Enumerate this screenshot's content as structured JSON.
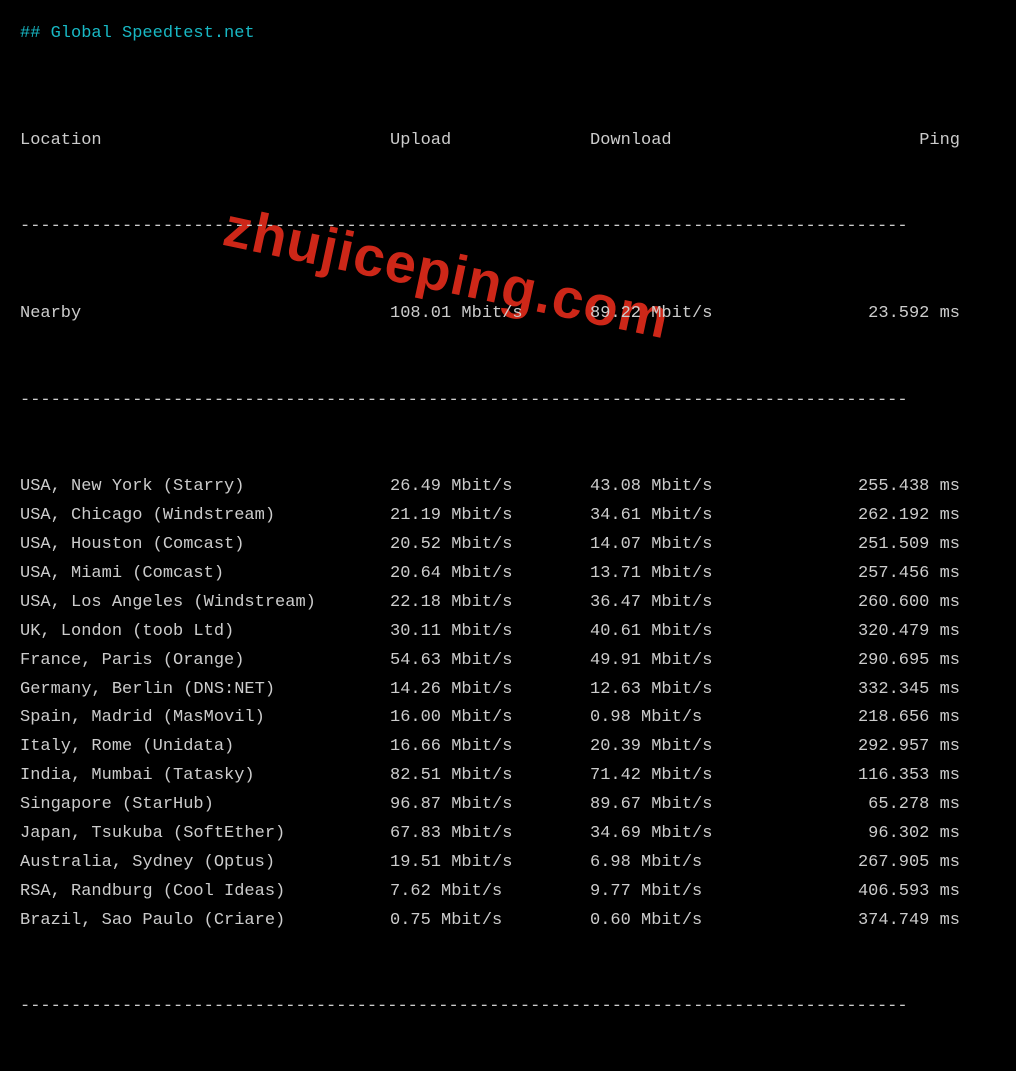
{
  "title": "## Global Speedtest.net",
  "headers": {
    "location": "Location",
    "upload": "Upload",
    "download": "Download",
    "ping": "Ping"
  },
  "separator": "---------------------------------------------------------------------------------------",
  "nearby": {
    "location": "Nearby",
    "upload": "108.01 Mbit/s",
    "download": "89.22 Mbit/s",
    "ping": "23.592 ms"
  },
  "rows": [
    {
      "location": "USA, New York (Starry)",
      "upload": "26.49 Mbit/s",
      "download": "43.08 Mbit/s",
      "ping": "255.438 ms"
    },
    {
      "location": "USA, Chicago (Windstream)",
      "upload": "21.19 Mbit/s",
      "download": "34.61 Mbit/s",
      "ping": "262.192 ms"
    },
    {
      "location": "USA, Houston (Comcast)",
      "upload": "20.52 Mbit/s",
      "download": "14.07 Mbit/s",
      "ping": "251.509 ms"
    },
    {
      "location": "USA, Miami (Comcast)",
      "upload": "20.64 Mbit/s",
      "download": "13.71 Mbit/s",
      "ping": "257.456 ms"
    },
    {
      "location": "USA, Los Angeles (Windstream)",
      "upload": "22.18 Mbit/s",
      "download": "36.47 Mbit/s",
      "ping": "260.600 ms"
    },
    {
      "location": "UK, London (toob Ltd)",
      "upload": "30.11 Mbit/s",
      "download": "40.61 Mbit/s",
      "ping": "320.479 ms"
    },
    {
      "location": "France, Paris (Orange)",
      "upload": "54.63 Mbit/s",
      "download": "49.91 Mbit/s",
      "ping": "290.695 ms"
    },
    {
      "location": "Germany, Berlin (DNS:NET)",
      "upload": "14.26 Mbit/s",
      "download": "12.63 Mbit/s",
      "ping": "332.345 ms"
    },
    {
      "location": "Spain, Madrid (MasMovil)",
      "upload": "16.00 Mbit/s",
      "download": "0.98 Mbit/s",
      "ping": "218.656 ms"
    },
    {
      "location": "Italy, Rome (Unidata)",
      "upload": "16.66 Mbit/s",
      "download": "20.39 Mbit/s",
      "ping": "292.957 ms"
    },
    {
      "location": "India, Mumbai (Tatasky)",
      "upload": "82.51 Mbit/s",
      "download": "71.42 Mbit/s",
      "ping": "116.353 ms"
    },
    {
      "location": "Singapore (StarHub)",
      "upload": "96.87 Mbit/s",
      "download": "89.67 Mbit/s",
      "ping": "65.278 ms"
    },
    {
      "location": "Japan, Tsukuba (SoftEther)",
      "upload": "67.83 Mbit/s",
      "download": "34.69 Mbit/s",
      "ping": "96.302 ms"
    },
    {
      "location": "Australia, Sydney (Optus)",
      "upload": "19.51 Mbit/s",
      "download": "6.98 Mbit/s",
      "ping": "267.905 ms"
    },
    {
      "location": "RSA, Randburg (Cool Ideas)",
      "upload": "7.62 Mbit/s",
      "download": "9.77 Mbit/s",
      "ping": "406.593 ms"
    },
    {
      "location": "Brazil, Sao Paulo (Criare)",
      "upload": "0.75 Mbit/s",
      "download": "0.60 Mbit/s",
      "ping": "374.749 ms"
    }
  ],
  "watermark": "zhujiceping.com"
}
